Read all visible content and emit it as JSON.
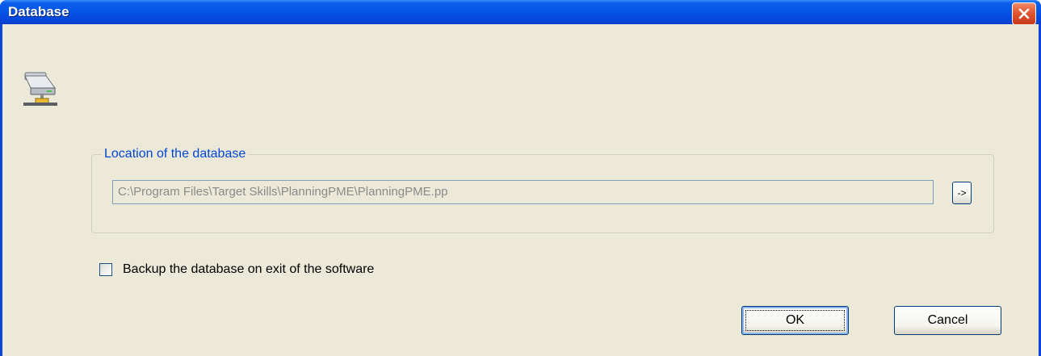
{
  "window": {
    "title": "Database",
    "close_icon": "close-icon"
  },
  "dialog": {
    "icon": "database-network-icon",
    "location_group": {
      "label": "Location of the database",
      "path_value": "C:\\Program Files\\Target Skills\\PlanningPME\\PlanningPME.pp",
      "browse_label": "->"
    },
    "backup": {
      "label": "Backup the database on exit of the software",
      "checked": false
    },
    "buttons": {
      "ok_label": "OK",
      "cancel_label": "Cancel"
    }
  },
  "colors": {
    "titlebar": "#0555e6",
    "client_background": "#ece9d8",
    "group_label": "#0046d5",
    "close_button": "#e0532e"
  }
}
